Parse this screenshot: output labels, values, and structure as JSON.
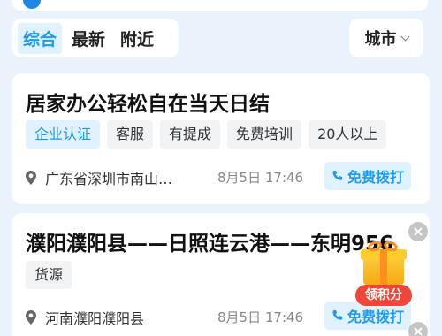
{
  "filter_tabs": [
    {
      "label": "综合",
      "active": true
    },
    {
      "label": "最新",
      "active": false
    },
    {
      "label": "附近",
      "active": false
    }
  ],
  "city_filter": {
    "label": "城市",
    "icon": "chevron-down-icon"
  },
  "listings": [
    {
      "title": "居家办公轻松自在当天日结",
      "tags": [
        "企业认证",
        "客服",
        "有提成",
        "免费培训",
        "20人以上"
      ],
      "location": "广东省深圳市南山…",
      "date": "8月5日 17:46",
      "call_label": "免费拨打"
    },
    {
      "title": "濮阳濮阳县——日照连云港——东明956",
      "tags": [
        "货源"
      ],
      "location": "河南濮阳濮阳县",
      "date": "8月5日 17:46",
      "call_label": "免费拨打"
    }
  ],
  "reward_widget": {
    "label": "领积分",
    "icon": "gift-icon"
  },
  "colors": {
    "accent": "#1e9af0",
    "accent_bg": "#e0f2ff",
    "page_bg": "#eaf3fb",
    "reward_red": "#f0463a"
  }
}
